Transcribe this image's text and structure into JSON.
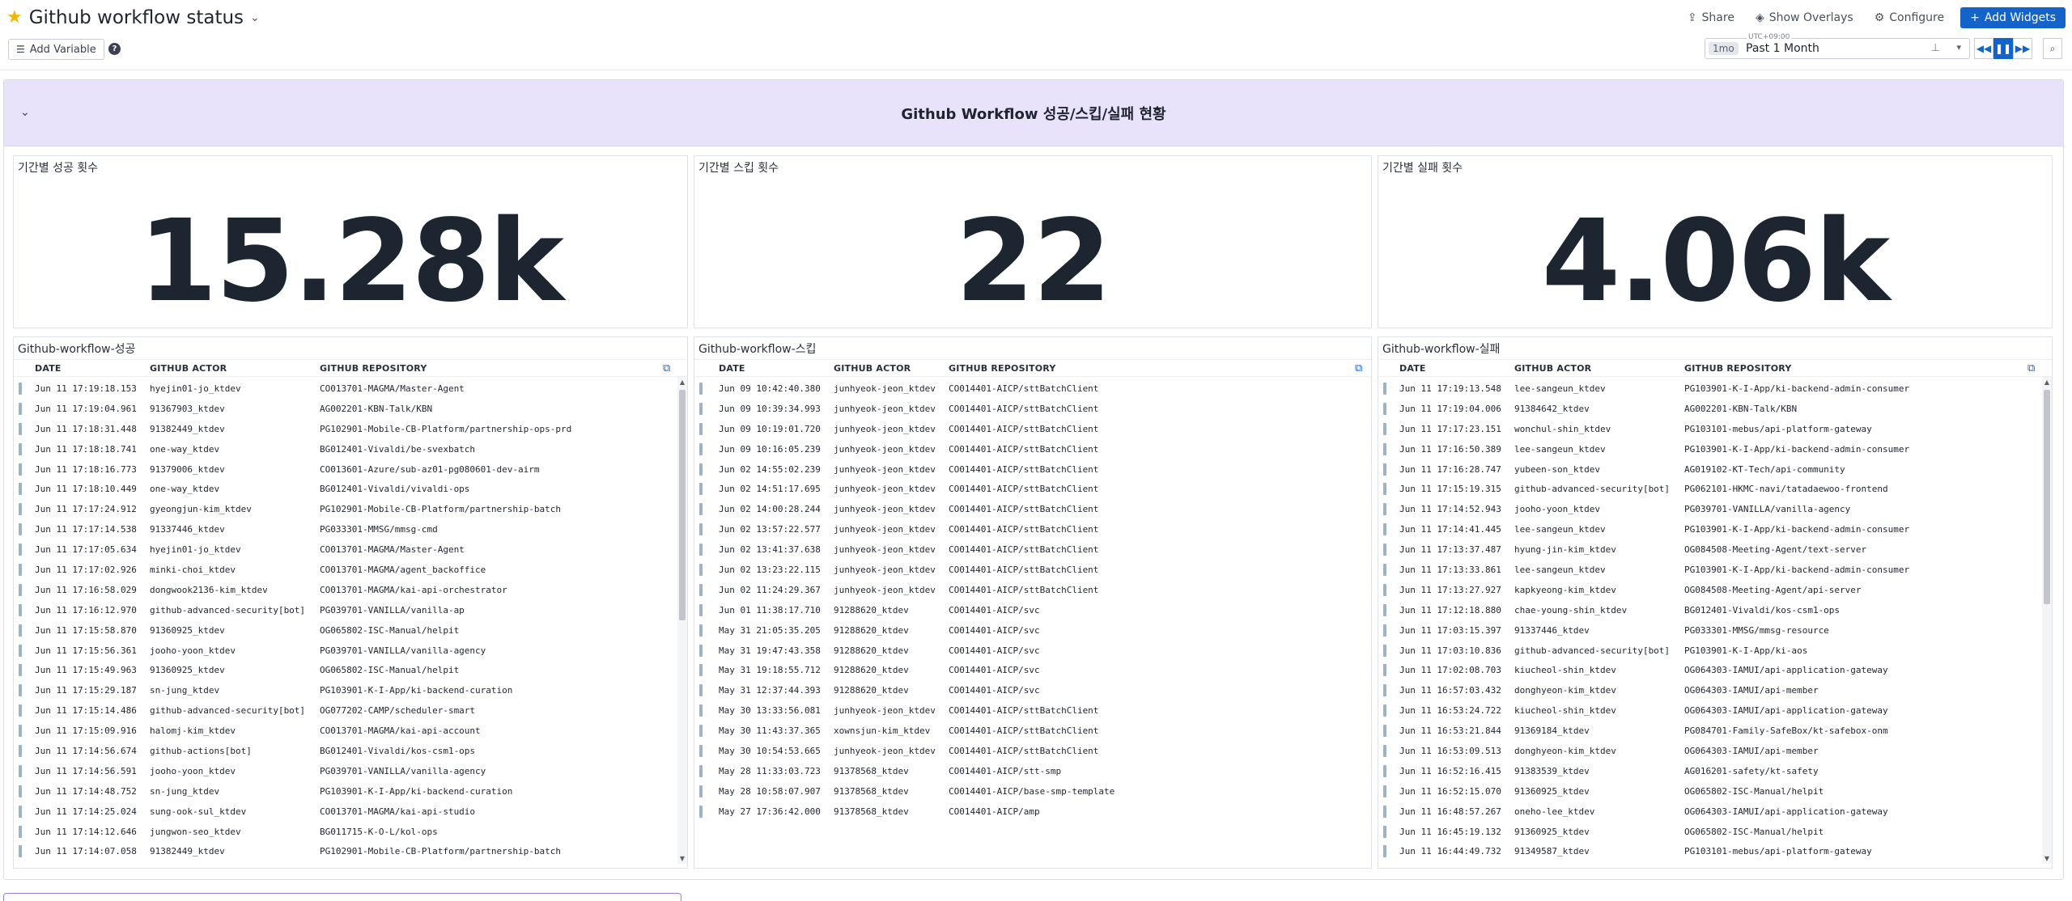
{
  "header": {
    "title": "Github workflow status",
    "actions": {
      "share": "Share",
      "overlays": "Show Overlays",
      "configure": "Configure",
      "add_widgets": "Add Widgets"
    }
  },
  "toolbar": {
    "add_variable": "Add Variable",
    "timezone": "UTC+09:00",
    "range_chip": "1mo",
    "range_label": "Past 1 Month"
  },
  "group": {
    "title": "Github Workflow 성공/스킵/실패 현황"
  },
  "stats": [
    {
      "title": "기간별 성공 횟수",
      "value": "15.28k"
    },
    {
      "title": "기간별 스킵 횟수",
      "value": "22"
    },
    {
      "title": "기간별 실패 횟수",
      "value": "4.06k"
    }
  ],
  "columns": {
    "date": "DATE",
    "actor": "GITHUB ACTOR",
    "repo": "GITHUB REPOSITORY"
  },
  "tables": [
    {
      "title": "Github-workflow-성공",
      "rows": [
        [
          "Jun 11 17:19:18.153",
          "hyejin01-jo_ktdev",
          "CO013701-MAGMA/Master-Agent"
        ],
        [
          "Jun 11 17:19:04.961",
          "91367903_ktdev",
          "AG002201-KBN-Talk/KBN"
        ],
        [
          "Jun 11 17:18:31.448",
          "91382449_ktdev",
          "PG102901-Mobile-CB-Platform/partnership-ops-prd"
        ],
        [
          "Jun 11 17:18:18.741",
          "one-way_ktdev",
          "BG012401-Vivaldi/be-svexbatch"
        ],
        [
          "Jun 11 17:18:16.773",
          "91379006_ktdev",
          "CO013601-Azure/sub-az01-pg080601-dev-airm"
        ],
        [
          "Jun 11 17:18:10.449",
          "one-way_ktdev",
          "BG012401-Vivaldi/vivaldi-ops"
        ],
        [
          "Jun 11 17:17:24.912",
          "gyeongjun-kim_ktdev",
          "PG102901-Mobile-CB-Platform/partnership-batch"
        ],
        [
          "Jun 11 17:17:14.538",
          "91337446_ktdev",
          "PG033301-MMSG/mmsg-cmd"
        ],
        [
          "Jun 11 17:17:05.634",
          "hyejin01-jo_ktdev",
          "CO013701-MAGMA/Master-Agent"
        ],
        [
          "Jun 11 17:17:02.926",
          "minki-choi_ktdev",
          "CO013701-MAGMA/agent_backoffice"
        ],
        [
          "Jun 11 17:16:58.029",
          "dongwook2136-kim_ktdev",
          "CO013701-MAGMA/kai-api-orchestrator"
        ],
        [
          "Jun 11 17:16:12.970",
          "github-advanced-security[bot]",
          "PG039701-VANILLA/vanilla-ap"
        ],
        [
          "Jun 11 17:15:58.870",
          "91360925_ktdev",
          "OG065802-ISC-Manual/helpit"
        ],
        [
          "Jun 11 17:15:56.361",
          "jooho-yoon_ktdev",
          "PG039701-VANILLA/vanilla-agency"
        ],
        [
          "Jun 11 17:15:49.963",
          "91360925_ktdev",
          "OG065802-ISC-Manual/helpit"
        ],
        [
          "Jun 11 17:15:29.187",
          "sn-jung_ktdev",
          "PG103901-K-I-App/ki-backend-curation"
        ],
        [
          "Jun 11 17:15:14.486",
          "github-advanced-security[bot]",
          "OG077202-CAMP/scheduler-smart"
        ],
        [
          "Jun 11 17:15:09.916",
          "halomj-kim_ktdev",
          "CO013701-MAGMA/kai-api-account"
        ],
        [
          "Jun 11 17:14:56.674",
          "github-actions[bot]",
          "BG012401-Vivaldi/kos-csm1-ops"
        ],
        [
          "Jun 11 17:14:56.591",
          "jooho-yoon_ktdev",
          "PG039701-VANILLA/vanilla-agency"
        ],
        [
          "Jun 11 17:14:48.752",
          "sn-jung_ktdev",
          "PG103901-K-I-App/ki-backend-curation"
        ],
        [
          "Jun 11 17:14:25.024",
          "sung-ook-sul_ktdev",
          "CO013701-MAGMA/kai-api-studio"
        ],
        [
          "Jun 11 17:14:12.646",
          "jungwon-seo_ktdev",
          "BG011715-K-O-L/kol-ops"
        ],
        [
          "Jun 11 17:14:07.058",
          "91382449_ktdev",
          "PG102901-Mobile-CB-Platform/partnership-batch"
        ]
      ]
    },
    {
      "title": "Github-workflow-스킵",
      "rows": [
        [
          "Jun 09 10:42:40.380",
          "junhyeok-jeon_ktdev",
          "CO014401-AICP/sttBatchClient"
        ],
        [
          "Jun 09 10:39:34.993",
          "junhyeok-jeon_ktdev",
          "CO014401-AICP/sttBatchClient"
        ],
        [
          "Jun 09 10:19:01.720",
          "junhyeok-jeon_ktdev",
          "CO014401-AICP/sttBatchClient"
        ],
        [
          "Jun 09 10:16:05.239",
          "junhyeok-jeon_ktdev",
          "CO014401-AICP/sttBatchClient"
        ],
        [
          "Jun 02 14:55:02.239",
          "junhyeok-jeon_ktdev",
          "CO014401-AICP/sttBatchClient"
        ],
        [
          "Jun 02 14:51:17.695",
          "junhyeok-jeon_ktdev",
          "CO014401-AICP/sttBatchClient"
        ],
        [
          "Jun 02 14:00:28.244",
          "junhyeok-jeon_ktdev",
          "CO014401-AICP/sttBatchClient"
        ],
        [
          "Jun 02 13:57:22.577",
          "junhyeok-jeon_ktdev",
          "CO014401-AICP/sttBatchClient"
        ],
        [
          "Jun 02 13:41:37.638",
          "junhyeok-jeon_ktdev",
          "CO014401-AICP/sttBatchClient"
        ],
        [
          "Jun 02 13:23:22.115",
          "junhyeok-jeon_ktdev",
          "CO014401-AICP/sttBatchClient"
        ],
        [
          "Jun 02 11:24:29.367",
          "junhyeok-jeon_ktdev",
          "CO014401-AICP/sttBatchClient"
        ],
        [
          "Jun 01 11:38:17.710",
          "91288620_ktdev",
          "CO014401-AICP/svc"
        ],
        [
          "May 31 21:05:35.205",
          "91288620_ktdev",
          "CO014401-AICP/svc"
        ],
        [
          "May 31 19:47:43.358",
          "91288620_ktdev",
          "CO014401-AICP/svc"
        ],
        [
          "May 31 19:18:55.712",
          "91288620_ktdev",
          "CO014401-AICP/svc"
        ],
        [
          "May 31 12:37:44.393",
          "91288620_ktdev",
          "CO014401-AICP/svc"
        ],
        [
          "May 30 13:33:56.081",
          "junhyeok-jeon_ktdev",
          "CO014401-AICP/sttBatchClient"
        ],
        [
          "May 30 11:43:37.365",
          "xownsjun-kim_ktdev",
          "CO014401-AICP/sttBatchClient"
        ],
        [
          "May 30 10:54:53.665",
          "junhyeok-jeon_ktdev",
          "CO014401-AICP/sttBatchClient"
        ],
        [
          "May 28 11:33:03.723",
          "91378568_ktdev",
          "CO014401-AICP/stt-smp"
        ],
        [
          "May 28 10:58:07.907",
          "91378568_ktdev",
          "CO014401-AICP/base-smp-template"
        ],
        [
          "May 27 17:36:42.000",
          "91378568_ktdev",
          "CO014401-AICP/amp"
        ]
      ]
    },
    {
      "title": "Github-workflow-실패",
      "rows": [
        [
          "Jun 11 17:19:13.548",
          "lee-sangeun_ktdev",
          "PG103901-K-I-App/ki-backend-admin-consumer"
        ],
        [
          "Jun 11 17:19:04.006",
          "91384642_ktdev",
          "AG002201-KBN-Talk/KBN"
        ],
        [
          "Jun 11 17:17:23.151",
          "wonchul-shin_ktdev",
          "PG103101-mebus/api-platform-gateway"
        ],
        [
          "Jun 11 17:16:50.389",
          "lee-sangeun_ktdev",
          "PG103901-K-I-App/ki-backend-admin-consumer"
        ],
        [
          "Jun 11 17:16:28.747",
          "yubeen-son_ktdev",
          "AG019102-KT-Tech/api-community"
        ],
        [
          "Jun 11 17:15:19.315",
          "github-advanced-security[bot]",
          "PG062101-HKMC-navi/tatadaewoo-frontend"
        ],
        [
          "Jun 11 17:14:52.943",
          "jooho-yoon_ktdev",
          "PG039701-VANILLA/vanilla-agency"
        ],
        [
          "Jun 11 17:14:41.445",
          "lee-sangeun_ktdev",
          "PG103901-K-I-App/ki-backend-admin-consumer"
        ],
        [
          "Jun 11 17:13:37.487",
          "hyung-jin-kim_ktdev",
          "OG084508-Meeting-Agent/text-server"
        ],
        [
          "Jun 11 17:13:33.861",
          "lee-sangeun_ktdev",
          "PG103901-K-I-App/ki-backend-admin-consumer"
        ],
        [
          "Jun 11 17:13:27.927",
          "kapkyeong-kim_ktdev",
          "OG084508-Meeting-Agent/api-server"
        ],
        [
          "Jun 11 17:12:18.880",
          "chae-young-shin_ktdev",
          "BG012401-Vivaldi/kos-csm1-ops"
        ],
        [
          "Jun 11 17:03:15.397",
          "91337446_ktdev",
          "PG033301-MMSG/mmsg-resource"
        ],
        [
          "Jun 11 17:03:10.836",
          "github-advanced-security[bot]",
          "PG103901-K-I-App/ki-aos"
        ],
        [
          "Jun 11 17:02:08.703",
          "kiucheol-shin_ktdev",
          "OG064303-IAMUI/api-application-gateway"
        ],
        [
          "Jun 11 16:57:03.432",
          "donghyeon-kim_ktdev",
          "OG064303-IAMUI/api-member"
        ],
        [
          "Jun 11 16:53:24.722",
          "kiucheol-shin_ktdev",
          "OG064303-IAMUI/api-application-gateway"
        ],
        [
          "Jun 11 16:53:21.844",
          "91369184_ktdev",
          "PG084701-Family-SafeBox/kt-safebox-onm"
        ],
        [
          "Jun 11 16:53:09.513",
          "donghyeon-kim_ktdev",
          "OG064303-IAMUI/api-member"
        ],
        [
          "Jun 11 16:52:16.415",
          "91383539_ktdev",
          "AG016201-safety/kt-safety"
        ],
        [
          "Jun 11 16:52:15.070",
          "91360925_ktdev",
          "OG065802-ISC-Manual/helpit"
        ],
        [
          "Jun 11 16:48:57.267",
          "oneho-lee_ktdev",
          "OG064303-IAMUI/api-application-gateway"
        ],
        [
          "Jun 11 16:45:19.132",
          "91360925_ktdev",
          "OG065802-ISC-Manual/helpit"
        ],
        [
          "Jun 11 16:44:49.732",
          "91349587_ktdev",
          "PG103101-mebus/api-platform-gateway"
        ]
      ]
    }
  ]
}
